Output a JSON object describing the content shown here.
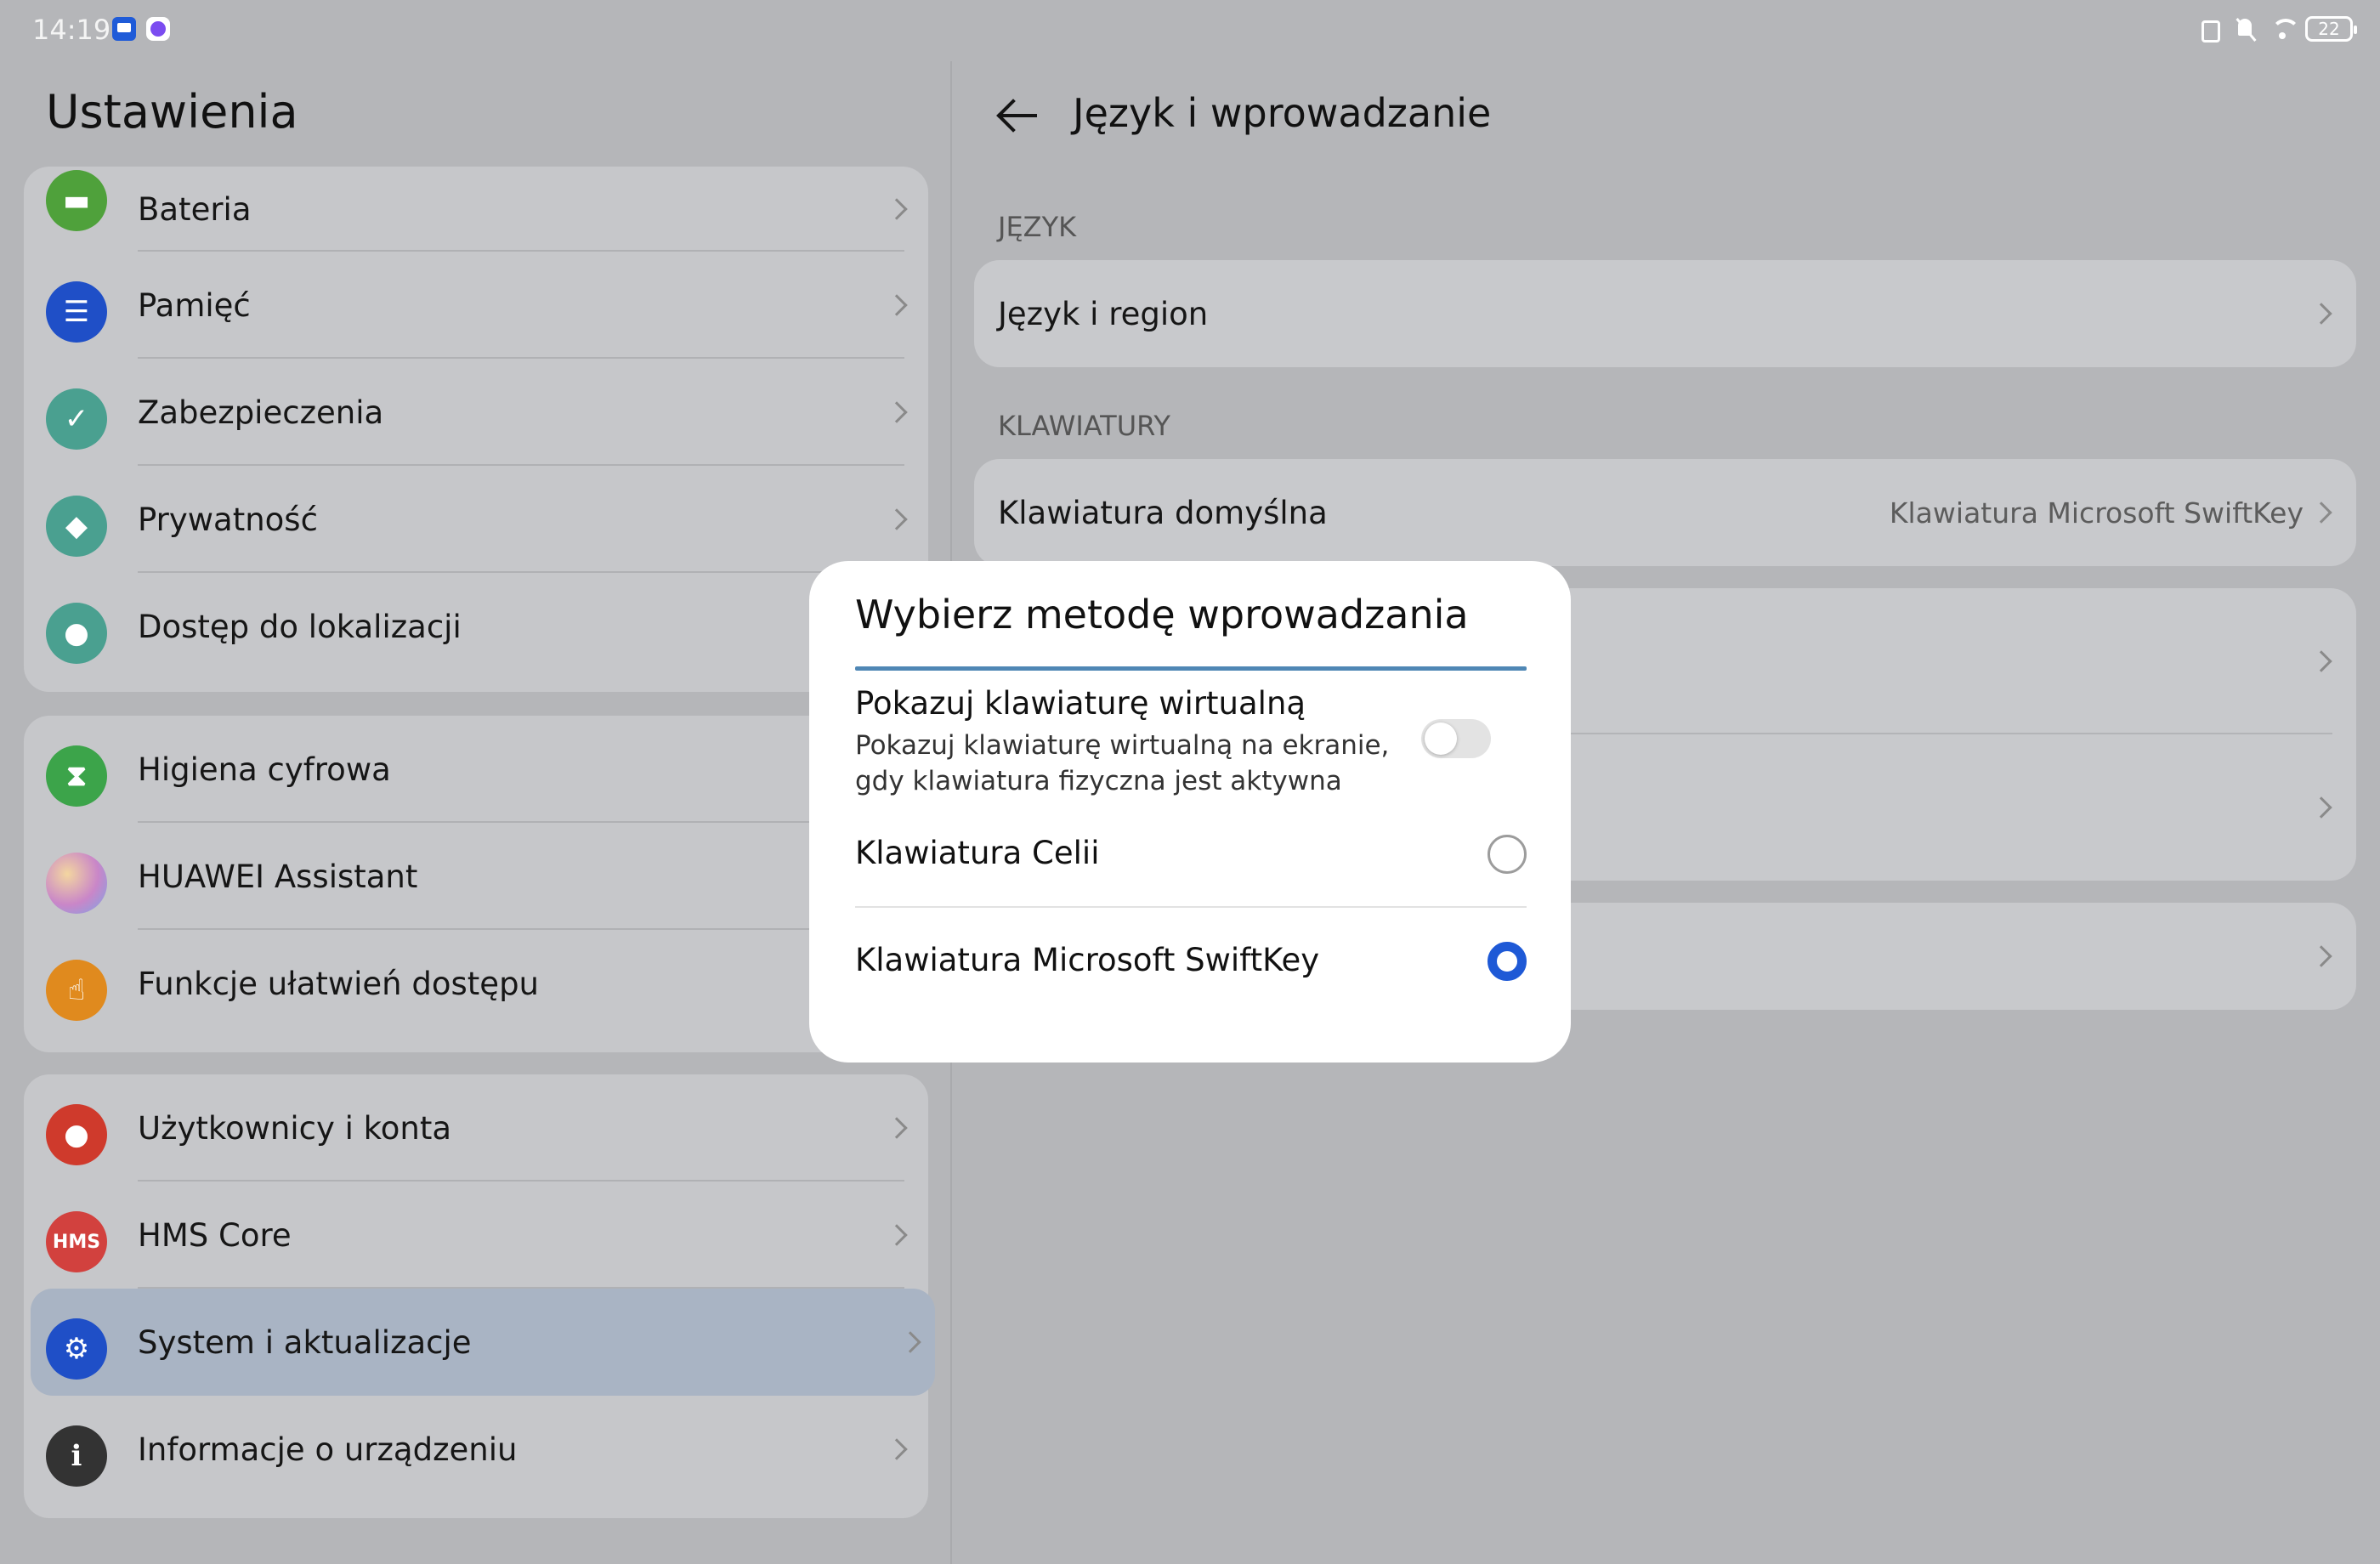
{
  "status_bar": {
    "time": "14:19",
    "battery": "22"
  },
  "settings": {
    "title": "Ustawienia",
    "groups": [
      [
        {
          "label": "Bateria",
          "icon": "battery-icon",
          "color": "#4fa13b"
        },
        {
          "label": "Pamięć",
          "icon": "storage-icon",
          "color": "#1f4fc7"
        },
        {
          "label": "Zabezpieczenia",
          "icon": "shield-check-icon",
          "color": "#4aa090"
        },
        {
          "label": "Prywatność",
          "icon": "privacy-shield-icon",
          "color": "#4aa090"
        },
        {
          "label": "Dostęp do lokalizacji",
          "icon": "location-icon",
          "color": "#4aa090"
        }
      ],
      [
        {
          "label": "Higiena cyfrowa",
          "icon": "hourglass-icon",
          "color": "#3ca44a"
        },
        {
          "label": "HUAWEI Assistant",
          "icon": "assistant-icon",
          "color": "#c98ac4"
        },
        {
          "label": "Funkcje ułatwień dostępu",
          "icon": "hand-icon",
          "color": "#e08a1e"
        }
      ],
      [
        {
          "label": "Użytkownicy i konta",
          "icon": "user-icon",
          "color": "#cf3a2c"
        },
        {
          "label": "HMS Core",
          "icon": "hms-icon",
          "color": "#d2413e",
          "text": "HMS"
        },
        {
          "label": "System i aktualizacje",
          "icon": "gear-icon",
          "color": "#1f4fc7"
        },
        {
          "label": "Informacje o urządzeniu",
          "icon": "info-icon",
          "color": "#333333"
        }
      ]
    ]
  },
  "language_page": {
    "title": "Język i wprowadzanie",
    "section_language": "JĘZYK",
    "language_region": "Język i region",
    "section_keyboards": "KLAWIATURY",
    "default_keyboard_label": "Klawiatura domyślna",
    "default_keyboard_value": "Klawiatura Microsoft SwiftKey"
  },
  "dialog": {
    "title": "Wybierz metodę wprowadzania",
    "virtual_kb_title": "Pokazuj klawiaturę wirtualną",
    "virtual_kb_subtitle": "Pokazuj klawiaturę wirtualną na ekranie, gdy klawiatura fizyczna jest aktywna",
    "virtual_kb_enabled": false,
    "options": [
      {
        "label": "Klawiatura Celii",
        "selected": false
      },
      {
        "label": "Klawiatura Microsoft SwiftKey",
        "selected": true
      }
    ],
    "accent_color": "#1e59d6"
  }
}
